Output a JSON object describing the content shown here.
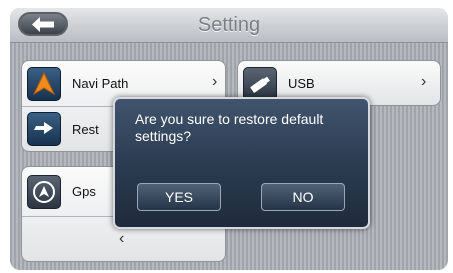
{
  "header": {
    "title": "Setting",
    "back_icon": "back-arrow-icon"
  },
  "left_card": {
    "items": [
      {
        "label": "Navi Path",
        "icon": "navigation-arrow-icon"
      },
      {
        "label": "Rest",
        "icon": "restore-icon"
      }
    ]
  },
  "right_card": {
    "items": [
      {
        "label": "USB",
        "icon": "usb-icon"
      }
    ]
  },
  "bottom_card": {
    "items": [
      {
        "label": "Gps",
        "icon": "gps-icon"
      }
    ],
    "prev_glyph": "‹"
  },
  "chevron_glyph": "›",
  "dialog": {
    "message": "Are you sure to restore default settings?",
    "yes_label": "YES",
    "no_label": "NO"
  }
}
